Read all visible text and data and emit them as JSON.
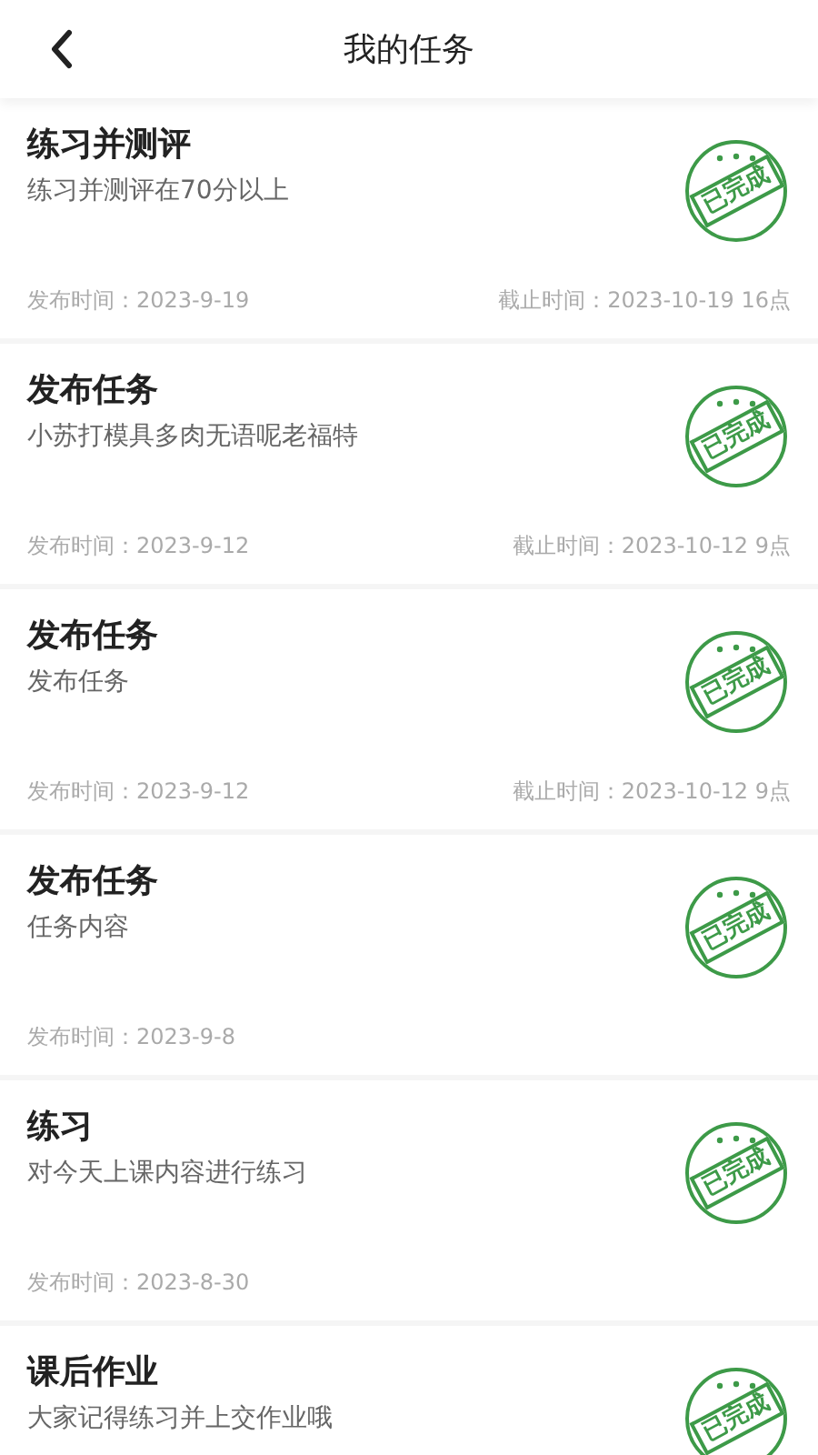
{
  "header": {
    "title": "我的任务"
  },
  "tasks": [
    {
      "title": "练习并测评",
      "description": "练习并测评在70分以上",
      "published": "发布时间：2023-9-19",
      "deadline": "截止时间：2023-10-19 16点",
      "completed": true,
      "stamp": "已完成"
    },
    {
      "title": "发布任务",
      "description": "小苏打模具多肉无语呢老福特",
      "published": "发布时间：2023-9-12",
      "deadline": "截止时间：2023-10-12 9点",
      "completed": true,
      "stamp": "已完成"
    },
    {
      "title": "发布任务",
      "description": "发布任务",
      "published": "发布时间：2023-9-12",
      "deadline": "截止时间：2023-10-12 9点",
      "completed": true,
      "stamp": "已完成"
    },
    {
      "title": "发布任务",
      "description": "任务内容",
      "published": "发布时间：2023-9-8",
      "completed": true,
      "stamp": "已完成"
    },
    {
      "title": "练习",
      "description": "对今天上课内容进行练习",
      "published": "发布时间：2023-8-30",
      "completed": true,
      "stamp": "已完成"
    },
    {
      "title": "课后作业",
      "description": "大家记得练习并上交作业哦",
      "completed": true,
      "stamp": "已完成"
    }
  ]
}
